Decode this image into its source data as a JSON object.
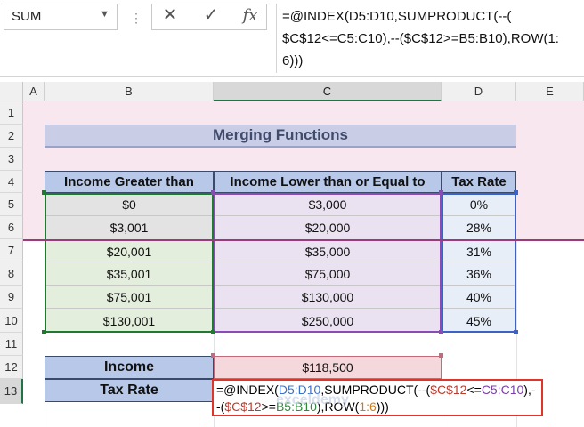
{
  "formula_bar": {
    "name_box": "SUM",
    "cancel_icon": "close-icon",
    "enter_icon": "check-icon",
    "fx_label": "fx",
    "formula_line1": "=@INDEX(D5:D10,SUMPRODUCT(--(",
    "formula_line2": "$C$12<=C5:C10),--($C$12>=B5:B10),ROW(1:",
    "formula_line3": "6)))"
  },
  "columns": [
    "A",
    "B",
    "C",
    "D",
    "E"
  ],
  "rows": [
    "1",
    "2",
    "3",
    "4",
    "5",
    "6",
    "7",
    "8",
    "9",
    "10",
    "11",
    "12",
    "13"
  ],
  "sheet": {
    "title": "Merging Functions",
    "headers": [
      "Income Greater than",
      "Income Lower than or Equal to",
      "Tax Rate"
    ],
    "table_rows": [
      {
        "b": "$0",
        "c": "$3,000",
        "d": "0%"
      },
      {
        "b": "$3,001",
        "c": "$20,000",
        "d": "28%"
      },
      {
        "b": "$20,001",
        "c": "$35,000",
        "d": "31%"
      },
      {
        "b": "$35,001",
        "c": "$75,000",
        "d": "36%"
      },
      {
        "b": "$75,001",
        "c": "$130,000",
        "d": "40%"
      },
      {
        "b": "$130,001",
        "c": "$250,000",
        "d": "45%"
      }
    ],
    "income_label": "Income",
    "income_value": "$118,500",
    "tax_rate_label": "Tax Rate",
    "edit_formula": {
      "p1": "=@INDEX(",
      "r1": "D5:D10",
      "p2": ",SUMPRODUCT(--(",
      "r2": "$C$12",
      "p3": "<=",
      "r3": "C5:C10",
      "p4": "),--(",
      "r4": "$C$12",
      "p5": ">=",
      "r5": "B5:B10",
      "p6": "),ROW(",
      "r6": "1:6",
      "p7": ")))"
    }
  },
  "watermark": "exceldemy"
}
